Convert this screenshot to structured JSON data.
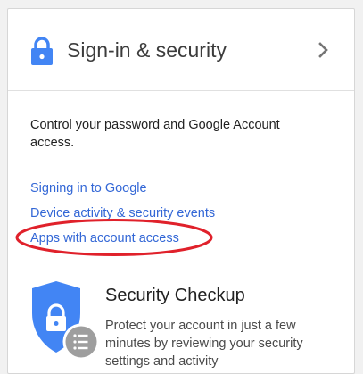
{
  "header": {
    "title": "Sign-in & security",
    "icon": "lock-icon",
    "chevron": "chevron-right-icon"
  },
  "section": {
    "description": "Control your password and Google Account access.",
    "links": [
      "Signing in to Google",
      "Device activity & security events",
      "Apps with account access"
    ]
  },
  "checkup": {
    "title": "Security Checkup",
    "description": "Protect your account in just a few minutes by reviewing your security settings and activity",
    "icon": "shield-lock-icon"
  },
  "colors": {
    "accent": "#4285f4",
    "link": "#3367d6",
    "highlight": "#e0212b"
  }
}
